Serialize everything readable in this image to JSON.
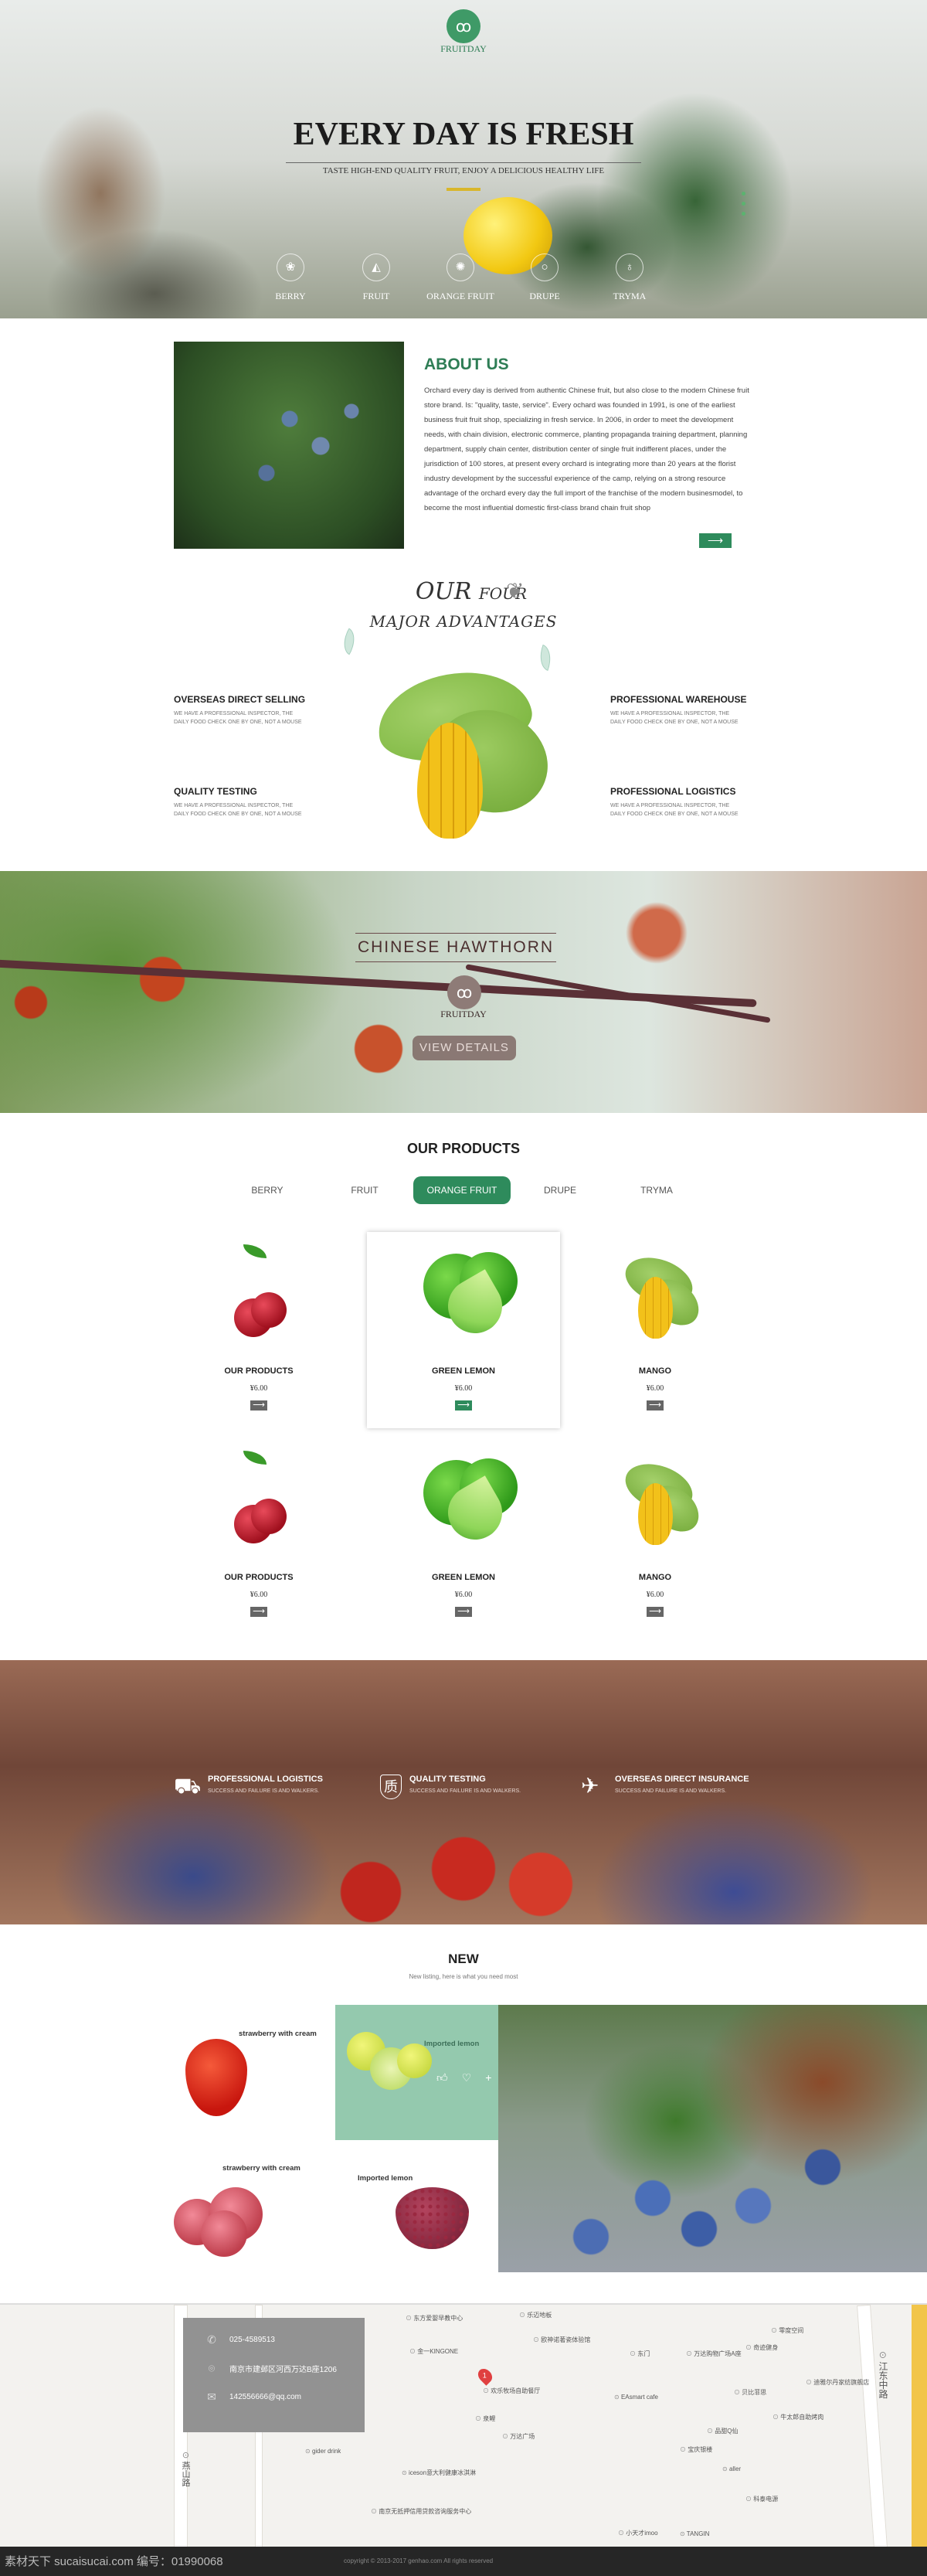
{
  "colors": {
    "brand_green": "#2e8b5c",
    "box_green": "#94c9ae",
    "footer": "#262626",
    "contact_box": "#929292"
  },
  "hero": {
    "brand": "FRUITDAY",
    "logo_icon": "cherry-icon",
    "title": "EVERY DAY IS FRESH",
    "subtitle": "TASTE HIGH-END QUALITY FRUIT, ENJOY A DELICIOUS HEALTHY LIFE",
    "nav": [
      {
        "label": "BERRY",
        "icon": "grapes-icon"
      },
      {
        "label": "FRUIT",
        "icon": "fruit-slice-icon"
      },
      {
        "label": "ORANGE FRUIT",
        "icon": "orange-slice-icon"
      },
      {
        "label": "DRUPE",
        "icon": "peach-icon"
      },
      {
        "label": "TRYMA",
        "icon": "apple-icon"
      }
    ]
  },
  "about": {
    "title": "ABOUT US",
    "text": "Orchard every day is derived from authentic Chinese fruit, but also close to the modern Chinese fruit store brand. Is: \"quality, taste, service\". Every ochard was founded in 1991, is one of the earliest business fruit fruit shop, specializing in fresh service. In 2006, in order to meet the development needs, with chain division, electronic commerce, planting propaganda training department, planning department, supply chain center, distribution center of single fruit indifferent places, under the jurisdiction of 100 stores, at present every orchard is integrating more than 20 years at the florist industry development by the successful experience of the camp, relying on a strong resource advantage of the orchard every day the full import of the franchise of the modern businesmodel, to become the most influential domestic first-class brand chain fruit shop",
    "more_icon": "arrow-right-icon"
  },
  "advantages": {
    "title_our": "OUR",
    "title_four": "FOUR",
    "title_line2": "MAJOR ADVANTAGES",
    "items": [
      {
        "title": "OVERSEAS DIRECT SELLING",
        "desc": "WE HAVE A PROFESSIONAL INSPECTOR, THE DAILY FOOD CHECK ONE BY ONE, NOT A MOUSE"
      },
      {
        "title": "PROFESSIONAL WAREHOUSE",
        "desc": "WE HAVE A PROFESSIONAL INSPECTOR, THE DAILY FOOD CHECK ONE BY ONE, NOT A MOUSE"
      },
      {
        "title": "QUALITY TESTING",
        "desc": "WE HAVE A PROFESSIONAL INSPECTOR, THE DAILY FOOD CHECK ONE BY ONE, NOT A MOUSE"
      },
      {
        "title": "PROFESSIONAL LOGISTICS",
        "desc": "WE HAVE A PROFESSIONAL INSPECTOR, THE DAILY FOOD CHECK ONE BY ONE, NOT A MOUSE"
      }
    ]
  },
  "hawthorn": {
    "title": "CHINESE HAWTHORN",
    "brand": "FRUITDAY",
    "button": "VIEW DETAILS"
  },
  "products": {
    "title": "OUR  PRODUCTS",
    "tabs": [
      "BERRY",
      "FRUIT",
      "ORANGE FRUIT",
      "DRUPE",
      "TRYMA"
    ],
    "active_tab": "ORANGE FRUIT",
    "items": [
      {
        "name": "OUR  PRODUCTS",
        "price": "¥6.00",
        "kind": "cherry"
      },
      {
        "name": "GREEN LEMON",
        "price": "¥6.00",
        "kind": "lime"
      },
      {
        "name": "MANGO",
        "price": "¥6.00",
        "kind": "mango"
      },
      {
        "name": "OUR  PRODUCTS",
        "price": "¥6.00",
        "kind": "cherry"
      },
      {
        "name": "GREEN LEMON",
        "price": "¥6.00",
        "kind": "lime"
      },
      {
        "name": "MANGO",
        "price": "¥6.00",
        "kind": "mango"
      }
    ]
  },
  "features": [
    {
      "title": "PROFESSIONAL LOGISTICS",
      "desc": "SUCCESS AND FAILURE IS  AND WALKERS.",
      "icon": "truck-icon"
    },
    {
      "title": "QUALITY TESTING",
      "desc": "SUCCESS AND FAILURE IS  AND WALKERS.",
      "icon": "quality-shield-icon",
      "glyph": "质"
    },
    {
      "title": "OVERSEAS DIRECT INSURANCE",
      "desc": "SUCCESS AND FAILURE IS  AND WALKERS.",
      "icon": "airplane-icon"
    }
  ],
  "new": {
    "title": "NEW",
    "subtitle": "New listing, here is what you need most",
    "items": [
      {
        "label": "strawberry with cream"
      },
      {
        "label": "Imported lemon"
      },
      {
        "label": "strawberry with cream"
      },
      {
        "label": "Imported lemon"
      }
    ]
  },
  "contact": {
    "phone": "025-4589513",
    "address": "南京市建邺区河西万达B座1206",
    "email": "142556666@qq.com"
  },
  "map": {
    "labels": [
      "东方爱婴早教中心",
      "乐迈地板",
      "欧神诺著瓷体验馆",
      "金一KINGONE",
      "东门",
      "万达购物广场A座",
      "零度空间",
      "奇迹健身",
      "欢乐牧场自助餐厅",
      "EAsmart cafe",
      "贝比菲思",
      "迪雅尔丹家纺旗舰店",
      "泉鲤",
      "牛太郎自助烤肉",
      "万达广场",
      "品甜Q仙",
      "宝庆银楼",
      "iceson意大利健康冰淇淋",
      "aller",
      "科泰电源",
      "南京无抵押信用贷款咨询服务中心",
      "gider drink",
      "燕山路",
      "江东中路",
      "小天才imoo",
      "TANGIN"
    ],
    "pin_number": "1"
  },
  "footer": {
    "watermark": "素材天下 sucaisucai.com  编号：01990068",
    "copyright": "copyright © 2013-2017  genhao.com All rights reserved"
  }
}
